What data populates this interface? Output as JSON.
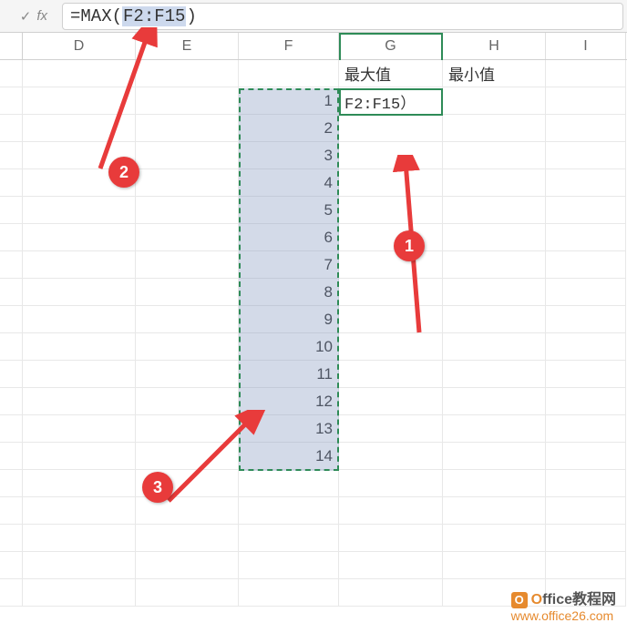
{
  "formula_bar": {
    "check_glyph": "✓",
    "fx_label": "fx",
    "eq": "=",
    "fn_name": "MAX",
    "open_paren": "(",
    "ref": "F2:F15",
    "close_paren": ")"
  },
  "columns": {
    "D": "D",
    "E": "E",
    "F": "F",
    "G": "G",
    "H": "H",
    "I": "I"
  },
  "headers": {
    "G1": "最大值",
    "H1": "最小值"
  },
  "active_cell_display": "F2:F15）",
  "F_values": [
    "1",
    "2",
    "3",
    "4",
    "5",
    "6",
    "7",
    "8",
    "9",
    "10",
    "11",
    "12",
    "13",
    "14"
  ],
  "callouts": {
    "c1": "1",
    "c2": "2",
    "c3": "3"
  },
  "watermark": {
    "logo_letter": "O",
    "title_o": "O",
    "title_rest": "ffice教程网",
    "url": "www.office26.com"
  },
  "chart_data": {
    "type": "table",
    "title": "Excel MAX formula demo",
    "columns": [
      "F",
      "G",
      "H"
    ],
    "header_row": {
      "G": "最大值",
      "H": "最小值"
    },
    "F_values": [
      1,
      2,
      3,
      4,
      5,
      6,
      7,
      8,
      9,
      10,
      11,
      12,
      13,
      14
    ],
    "formula_in_G2": "=MAX(F2:F15)",
    "selected_range": "F2:F15",
    "active_cell": "G2"
  }
}
